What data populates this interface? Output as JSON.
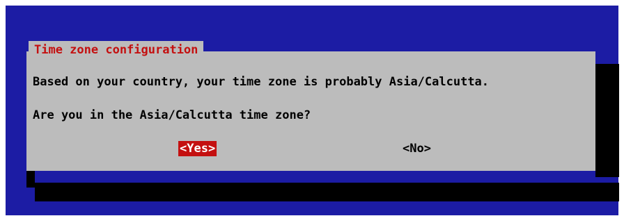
{
  "colors": {
    "background": "#1c1ca4",
    "dialog": "#bcbcbc",
    "title_text": "#c41010",
    "selected_button_bg": "#c41010",
    "selected_button_text": "#ffffff",
    "shadow": "#000000"
  },
  "dialog": {
    "title": "Time zone configuration",
    "message": "Based on your country, your time zone is probably Asia/Calcutta.",
    "question": "Are you in the Asia/Calcutta time zone?",
    "buttons": {
      "yes": {
        "label": "<Yes>",
        "selected": true
      },
      "no": {
        "label": "<No>",
        "selected": false
      }
    }
  }
}
